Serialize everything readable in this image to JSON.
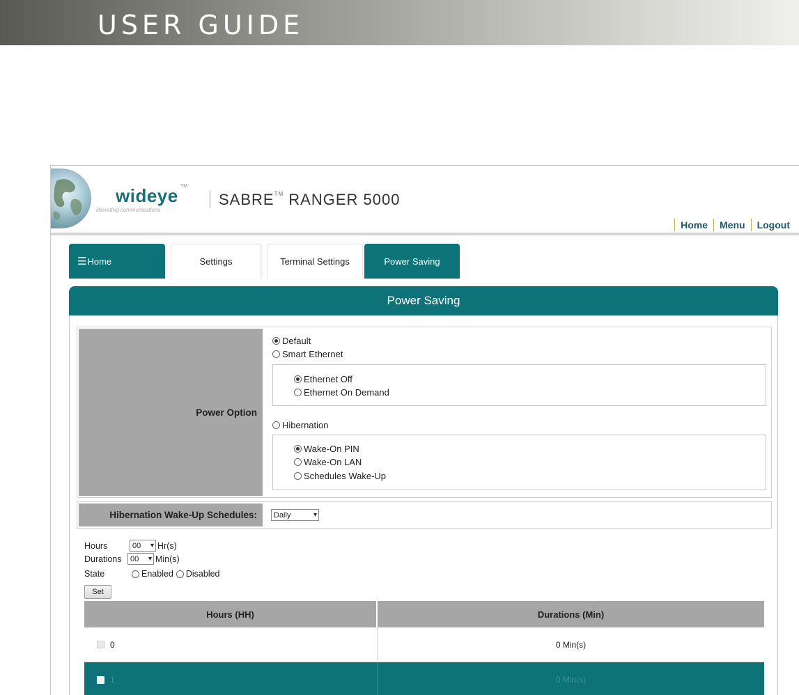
{
  "guide": {
    "title": "USER GUIDE"
  },
  "brand": {
    "logo_word": "wideye",
    "logo_tm": "TM",
    "tagline": "liberating communications",
    "product": "SABRE",
    "product_tm": "TM",
    "product_model": "RANGER 5000"
  },
  "toplinks": {
    "home": "Home",
    "menu": "Menu",
    "logout": "Logout"
  },
  "tabs": {
    "home": "Home",
    "settings": "Settings",
    "terminal": "Terminal Settings",
    "power": "Power Saving"
  },
  "panel": {
    "title": "Power Saving"
  },
  "power_option": {
    "label": "Power Option",
    "default": "Default",
    "smart_ethernet": "Smart Ethernet",
    "ethernet_off": "Ethernet Off",
    "ethernet_on_demand": "Ethernet On Demand",
    "hibernation": "Hibernation",
    "wake_on_pin": "Wake-On PIN",
    "wake_on_lan": "Wake-On LAN",
    "schedules_wake_up": "Schedules Wake-Up"
  },
  "schedules": {
    "label": "Hibernation Wake-Up Schedules:",
    "value": "Daily"
  },
  "form": {
    "hours_label": "Hours",
    "hours_value": "00",
    "hours_unit": "Hr(s)",
    "durations_label": "Durations",
    "durations_value": "00",
    "durations_unit": "Min(s)",
    "state_label": "State",
    "enabled": "Enabled",
    "disabled": "Disabled",
    "set_button": "Set"
  },
  "table": {
    "headers": [
      "Hours (HH)",
      "Durations (Min)"
    ],
    "rows": [
      {
        "hour": "0",
        "duration": "0 Min(s)"
      },
      {
        "hour": "1",
        "duration": "0 Min(s)"
      }
    ]
  },
  "colors": {
    "teal": "#0d7378",
    "gray_label": "#a6a6a6",
    "link": "#1d5a6b"
  }
}
